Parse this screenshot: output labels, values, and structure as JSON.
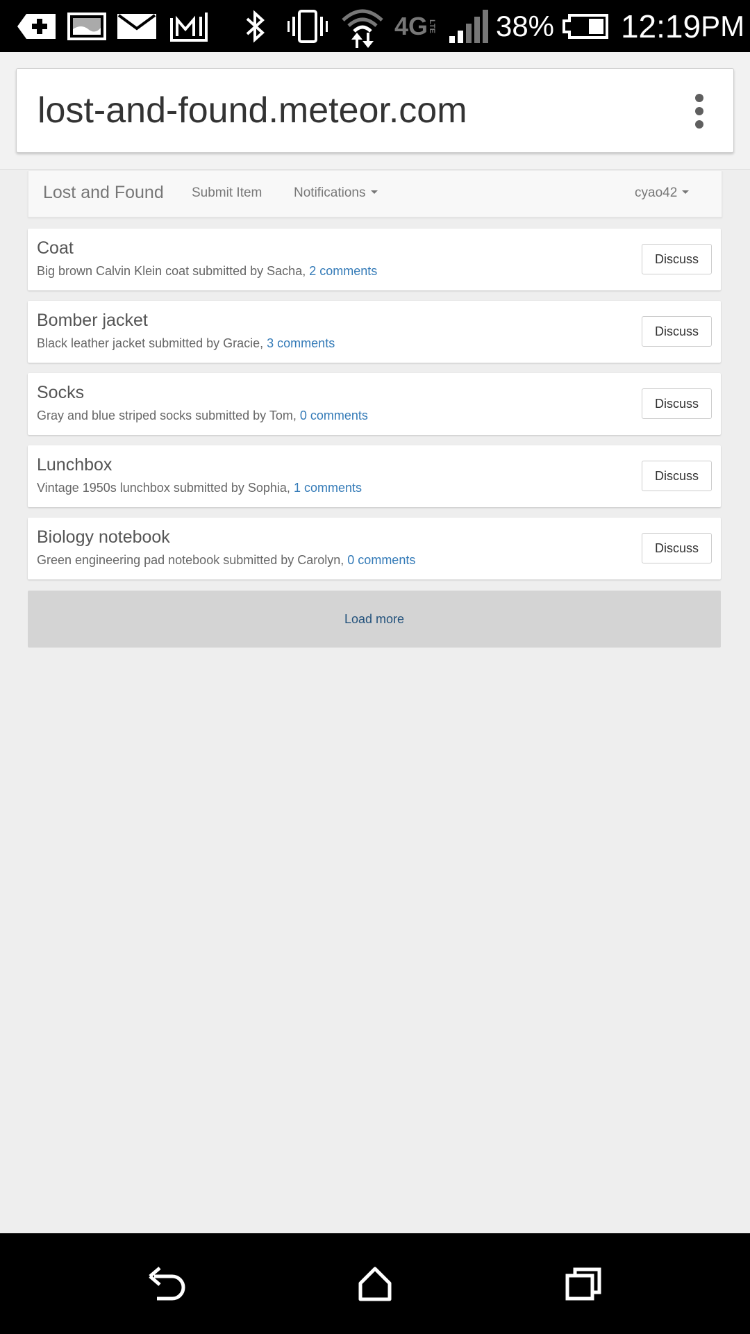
{
  "status_bar": {
    "network": "4G",
    "network_sub": "LTE",
    "battery": "38%",
    "time": "12:19",
    "ampm": "PM"
  },
  "browser": {
    "url": "lost-and-found.meteor.com"
  },
  "navbar": {
    "brand": "Lost and Found",
    "submit": "Submit Item",
    "notifications": "Notifications",
    "user": "cyao42"
  },
  "items": [
    {
      "title": "Coat",
      "desc": "Big brown Calvin Klein coat submitted by Sacha, ",
      "comments": "2 comments",
      "button": "Discuss"
    },
    {
      "title": "Bomber jacket",
      "desc": "Black leather jacket submitted by Gracie, ",
      "comments": "3 comments",
      "button": "Discuss"
    },
    {
      "title": "Socks",
      "desc": "Gray and blue striped socks submitted by Tom, ",
      "comments": "0 comments",
      "button": "Discuss"
    },
    {
      "title": "Lunchbox",
      "desc": "Vintage 1950s lunchbox submitted by Sophia, ",
      "comments": "1 comments",
      "button": "Discuss"
    },
    {
      "title": "Biology notebook",
      "desc": "Green engineering pad notebook submitted by Carolyn, ",
      "comments": "0 comments",
      "button": "Discuss"
    }
  ],
  "load_more": "Load more",
  "colors": {
    "link": "#337ab7",
    "page_bg": "#eeeeee",
    "load_more_bg": "#d4d4d4"
  }
}
